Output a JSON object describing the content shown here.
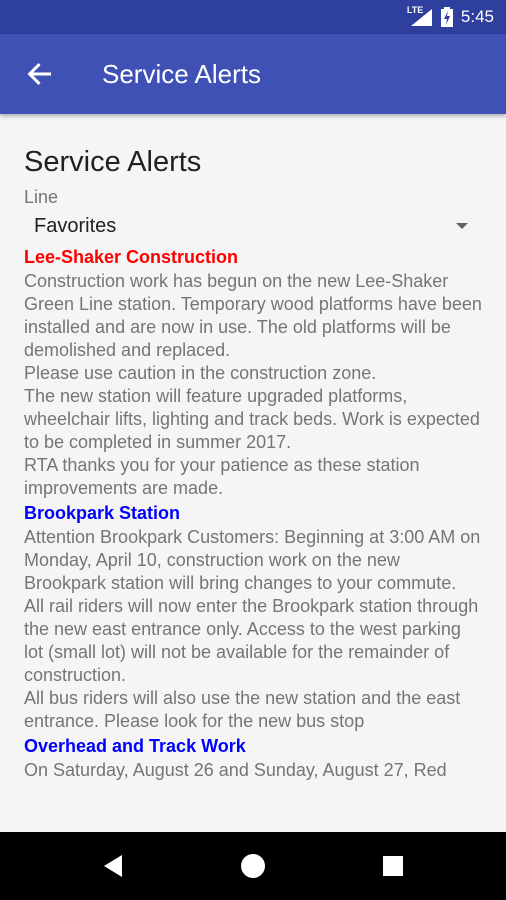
{
  "status": {
    "network": "LTE",
    "time": "5:45"
  },
  "appbar": {
    "title": "Service Alerts"
  },
  "page": {
    "title": "Service Alerts",
    "line_label": "Line",
    "line_selected": "Favorites"
  },
  "alerts": [
    {
      "title": "Lee-Shaker Construction",
      "color": "#ff0000",
      "body": [
        "Construction work has begun on the new Lee-Shaker Green Line station. Temporary wood platforms have been installed and are now in use. The old platforms will be demolished and replaced.",
        "Please use caution in the construction zone.",
        "The new station will feature upgraded platforms, wheelchair lifts, lighting and track beds. Work is expected to be completed in summer 2017.",
        "RTA thanks you for your patience as these station improvements are made."
      ]
    },
    {
      "title": "Brookpark Station",
      "color": "#0000ff",
      "body": [
        "Attention Brookpark Customers: Beginning at 3:00 AM on Monday, April 10, construction work on the new Brookpark station will bring changes to your commute.",
        "All rail riders will now enter the Brookpark station through the new east entrance only. Access to the west parking lot (small lot) will not be available for the remainder of construction.",
        "All bus riders will also use the new station and the east entrance. Please look for the new bus stop"
      ]
    },
    {
      "title": "Overhead and Track Work",
      "color": "#0000ff",
      "body": [
        "On Saturday, August 26 and Sunday, August 27, Red"
      ]
    }
  ],
  "colors": {
    "primary": "#3f51b5",
    "primary_dark": "#2f3f9e"
  }
}
